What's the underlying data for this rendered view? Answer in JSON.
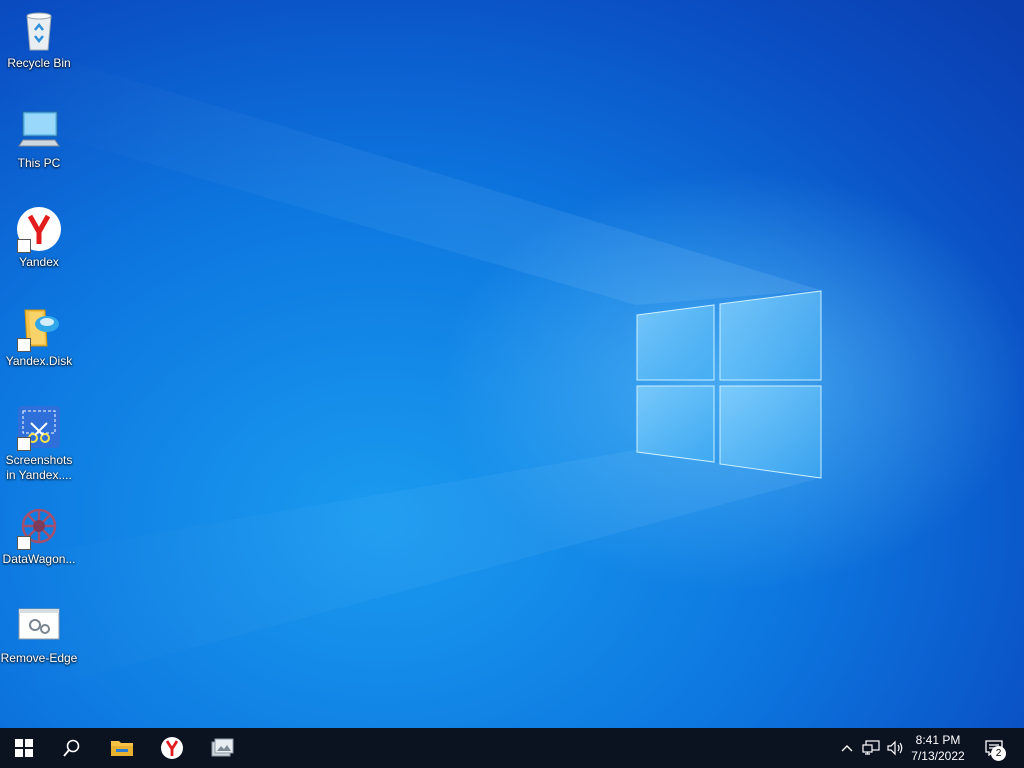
{
  "desktop": {
    "icons": [
      {
        "label": "Recycle Bin",
        "icon": "recycle-bin-icon"
      },
      {
        "label": "This PC",
        "icon": "computer-icon"
      },
      {
        "label": "Yandex",
        "icon": "yandex-browser-icon"
      },
      {
        "label": "Yandex.Disk",
        "icon": "yandex-disk-icon"
      },
      {
        "label": "Screenshots in Yandex....",
        "icon": "screenshot-scissors-icon"
      },
      {
        "label": "DataWagon...",
        "icon": "datawagon-icon"
      },
      {
        "label": "Remove-Edge",
        "icon": "script-window-icon"
      }
    ]
  },
  "taskbar": {
    "start": "windows-logo-icon",
    "search": "search-icon",
    "pinned": [
      "file-explorer-icon",
      "yandex-browser-icon",
      "photo-app-icon"
    ],
    "tray": {
      "chevron": "chevron-up-icon",
      "network": "network-icon",
      "volume": "volume-icon",
      "time": "8:41 PM",
      "date": "7/13/2022",
      "notifications": "notification-icon",
      "notification_count": "2"
    }
  },
  "colors": {
    "accent": "#0d78e0",
    "taskbar": "#0b1220"
  }
}
